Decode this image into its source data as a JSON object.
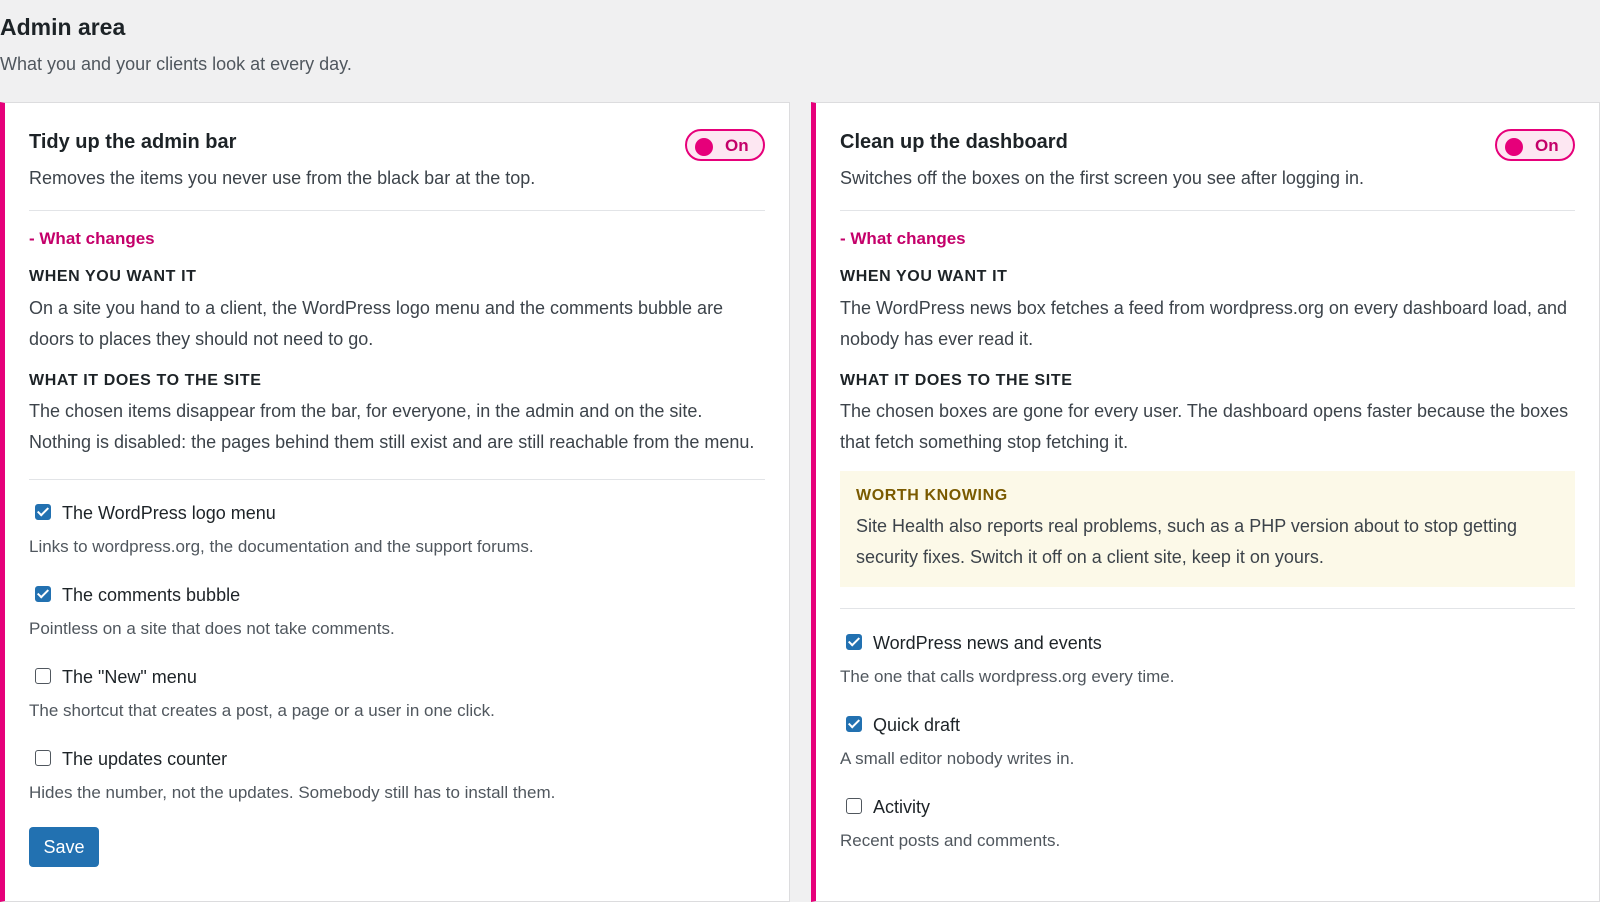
{
  "header": {
    "title": "Admin area",
    "subtitle": "What you and your clients look at every day."
  },
  "colors": {
    "accent": "#e6007a",
    "button": "#2271b1",
    "note_bg": "#fcf9e8"
  },
  "cards": [
    {
      "title": "Tidy up the admin bar",
      "description": "Removes the items you never use from the black bar at the top.",
      "toggle_label": "On",
      "toggle_on": true,
      "changes_link": "- What changes",
      "when_head": "WHEN YOU WANT IT",
      "when_text": "On a site you hand to a client, the WordPress logo menu and the comments bubble are doors to places they should not need to go.",
      "does_head": "WHAT IT DOES TO THE SITE",
      "does_text": "The chosen items disappear from the bar, for everyone, in the admin and on the site. Nothing is disabled: the pages behind them still exist and are still reachable from the menu.",
      "options": [
        {
          "label": "The WordPress logo menu",
          "help": "Links to wordpress.org, the documentation and the support forums.",
          "checked": true
        },
        {
          "label": "The comments bubble",
          "help": "Pointless on a site that does not take comments.",
          "checked": true
        },
        {
          "label": "The \"New\" menu",
          "help": "The shortcut that creates a post, a page or a user in one click.",
          "checked": false
        },
        {
          "label": "The updates counter",
          "help": "Hides the number, not the updates. Somebody still has to install them.",
          "checked": false
        }
      ],
      "save_label": "Save"
    },
    {
      "title": "Clean up the dashboard",
      "description": "Switches off the boxes on the first screen you see after logging in.",
      "toggle_label": "On",
      "toggle_on": true,
      "changes_link": "- What changes",
      "when_head": "WHEN YOU WANT IT",
      "when_text": "The WordPress news box fetches a feed from wordpress.org on every dashboard load, and nobody has ever read it.",
      "does_head": "WHAT IT DOES TO THE SITE",
      "does_text": "The chosen boxes are gone for every user. The dashboard opens faster because the boxes that fetch something stop fetching it.",
      "note_head": "WORTH KNOWING",
      "note_text": "Site Health also reports real problems, such as a PHP version about to stop getting security fixes. Switch it off on a client site, keep it on yours.",
      "options": [
        {
          "label": "WordPress news and events",
          "help": "The one that calls wordpress.org every time.",
          "checked": true
        },
        {
          "label": "Quick draft",
          "help": "A small editor nobody writes in.",
          "checked": true
        },
        {
          "label": "Activity",
          "help": "Recent posts and comments.",
          "checked": false
        }
      ]
    }
  ]
}
